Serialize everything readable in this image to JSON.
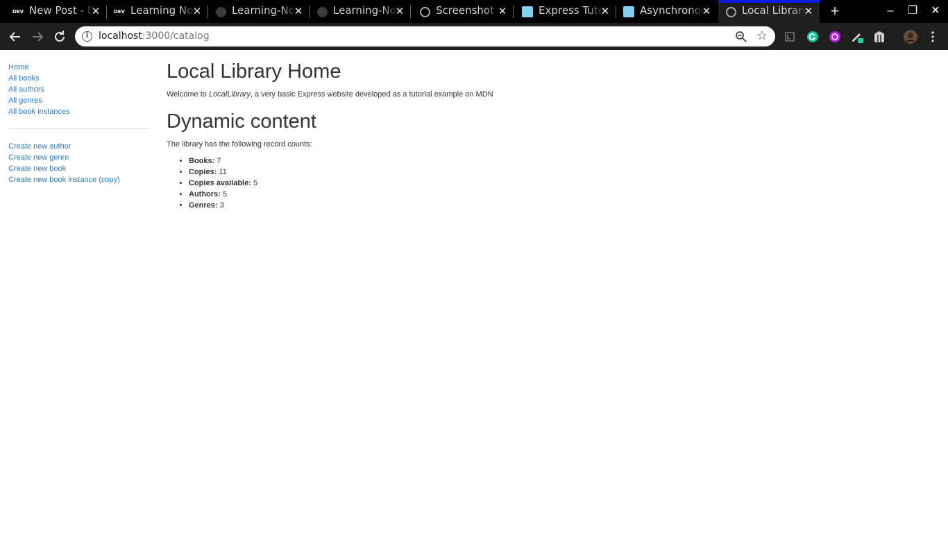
{
  "browser": {
    "tabs": [
      {
        "title": "New Post - DEV",
        "favicon": "dev-icon",
        "active": false
      },
      {
        "title": "Learning Notes",
        "favicon": "dev-icon",
        "active": false
      },
      {
        "title": "Learning-Notes",
        "favicon": "github-icon",
        "active": false
      },
      {
        "title": "Learning-Notes",
        "favicon": "github-icon",
        "active": false
      },
      {
        "title": "Screenshot",
        "favicon": "globe-icon",
        "active": false
      },
      {
        "title": "Express Tutorial",
        "favicon": "mdn-icon",
        "active": false
      },
      {
        "title": "Asynchronous",
        "favicon": "mdn-icon",
        "active": false
      },
      {
        "title": "Local Library",
        "favicon": "globe-icon",
        "active": true
      }
    ],
    "dev_badge": "DEV",
    "new_tab_symbol": "+",
    "window_controls": {
      "minimize": "–",
      "restore": "❐",
      "close": "✕"
    },
    "close_symbol": "✕",
    "url_host": "localhost",
    "url_rest": ":3000/catalog",
    "accent_color": "#0b1ee0"
  },
  "sidebar": {
    "primary_links": [
      {
        "label": "Home"
      },
      {
        "label": "All books"
      },
      {
        "label": "All authors"
      },
      {
        "label": "All genres"
      },
      {
        "label": "All book instances"
      }
    ],
    "create_links": [
      {
        "label": "Create new author"
      },
      {
        "label": "Create new genre"
      },
      {
        "label": "Create new book"
      },
      {
        "label": "Create new book instance (copy)"
      }
    ],
    "link_color": "#337ab7"
  },
  "main": {
    "title": "Local Library Home",
    "welcome_prefix": "Welcome to ",
    "welcome_emphasis": "LocalLibrary",
    "welcome_suffix": ", a very basic Express website developed as a tutorial example on MDN",
    "dynamic_heading": "Dynamic content",
    "counts_intro": "The library has the following record counts:",
    "counts": [
      {
        "label": "Books:",
        "value": "7"
      },
      {
        "label": "Copies:",
        "value": "11"
      },
      {
        "label": "Copies available:",
        "value": "5"
      },
      {
        "label": "Authors:",
        "value": "5"
      },
      {
        "label": "Genres:",
        "value": "3"
      }
    ]
  }
}
